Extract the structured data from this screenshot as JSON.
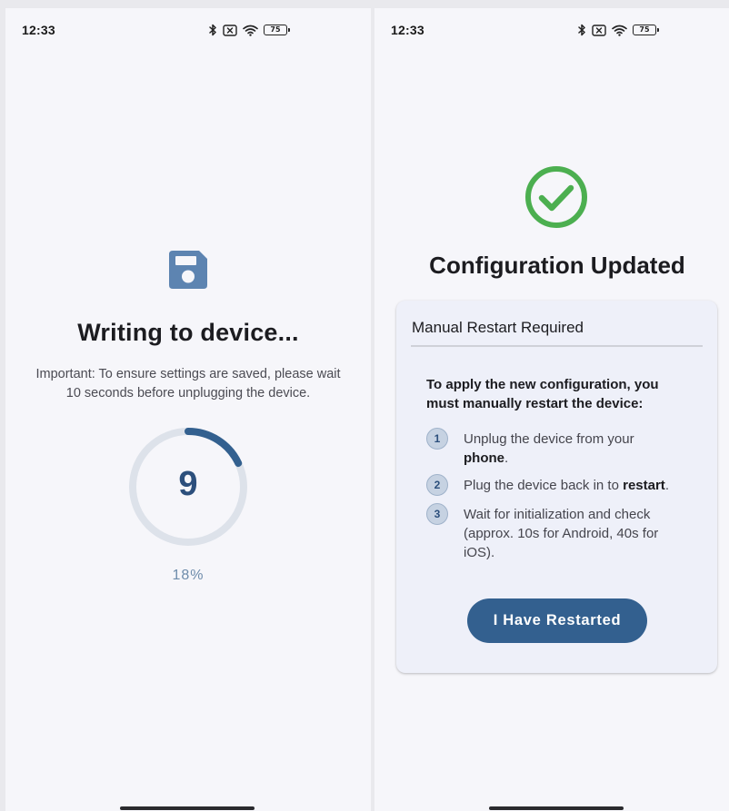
{
  "left": {
    "status": {
      "time": "12:33",
      "battery": "75"
    },
    "title": "Writing to device...",
    "note": "Important: To ensure settings are saved, please wait 10 seconds before unplugging the device.",
    "countdown": "9",
    "progress_fraction": 0.18,
    "progress_label": "18%",
    "icons": [
      "floppy-disk-icon"
    ]
  },
  "right": {
    "status": {
      "time": "12:33",
      "battery": "75"
    },
    "title": "Configuration Updated",
    "card": {
      "header": "Manual Restart Required",
      "intro": "To apply the new configuration, you must manually restart the device:",
      "steps": [
        {
          "num": "1",
          "before": "Unplug the device from your ",
          "bold": "phone",
          "after": "."
        },
        {
          "num": "2",
          "before": "Plug the device back in to ",
          "bold": "restart",
          "after": "."
        },
        {
          "num": "3",
          "before": "Wait for initialization and check (approx. 10s for Android, 40s for iOS).",
          "bold": "",
          "after": ""
        }
      ],
      "button_label": "I Have Restarted"
    },
    "icons": [
      "check-circle-icon"
    ]
  },
  "colors": {
    "accent": "#33608f",
    "ring_track": "#dde2ea",
    "ring_fill": "#33608f",
    "success": "#4caf50",
    "background": "#f6f6fa"
  }
}
